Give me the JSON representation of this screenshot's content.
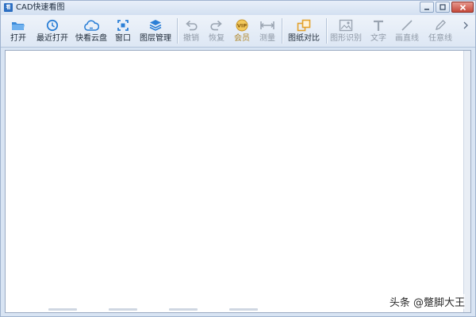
{
  "window": {
    "title": "CAD快速看图",
    "app_icon_text": "看"
  },
  "toolbar": {
    "open": "打开",
    "recent_open": "最近打开",
    "cloud_disk": "快看云盘",
    "window": "窗口",
    "layer_manage": "图层管理",
    "undo": "撤销",
    "redo": "恢复",
    "member": "会员",
    "measure": "测量",
    "drawing_compare": "图纸对比",
    "drawing_recognize": "图形识别",
    "text": "文字",
    "draw_line": "画直线",
    "freehand": "任意线"
  },
  "watermark": "头条 @蹩脚大王",
  "colors": {
    "accent_blue": "#2b7fd6",
    "vip_gold": "#c7952a",
    "disabled_gray": "#8f99a6",
    "orange": "#e3a12b"
  }
}
